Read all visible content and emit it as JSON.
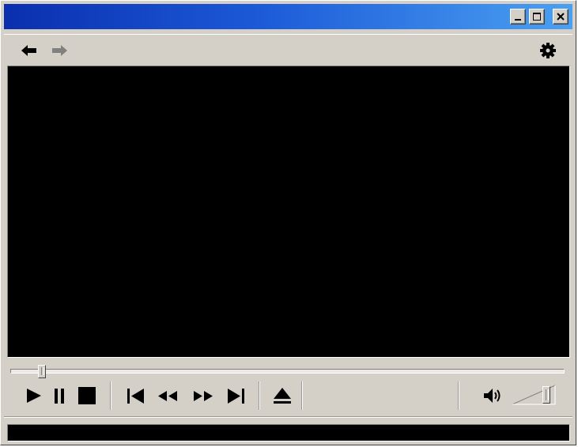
{
  "window": {
    "title": ""
  },
  "titlebar": {
    "gradient_start": "#0a2fae",
    "gradient_end": "#4aa0f2",
    "buttons": {
      "minimize_icon": "minimize-icon",
      "maximize_icon": "maximize-icon",
      "close_icon": "close-icon"
    }
  },
  "navbar": {
    "back_icon": "arrow-left-icon",
    "forward_icon": "arrow-right-icon",
    "settings_icon": "gear-icon",
    "forward_enabled": false
  },
  "player": {
    "seek_progress": 0.05,
    "volume_level": 0.85,
    "controls": [
      "play-icon",
      "pause-icon",
      "stop-icon",
      "skip-previous-icon",
      "rewind-icon",
      "fast-forward-icon",
      "skip-next-icon",
      "eject-icon",
      "speaker-icon"
    ],
    "status_text": ""
  },
  "colors": {
    "chrome": "#d4d0c8",
    "screen": "#000000",
    "icon": "#000000",
    "icon_disabled": "#808080"
  }
}
